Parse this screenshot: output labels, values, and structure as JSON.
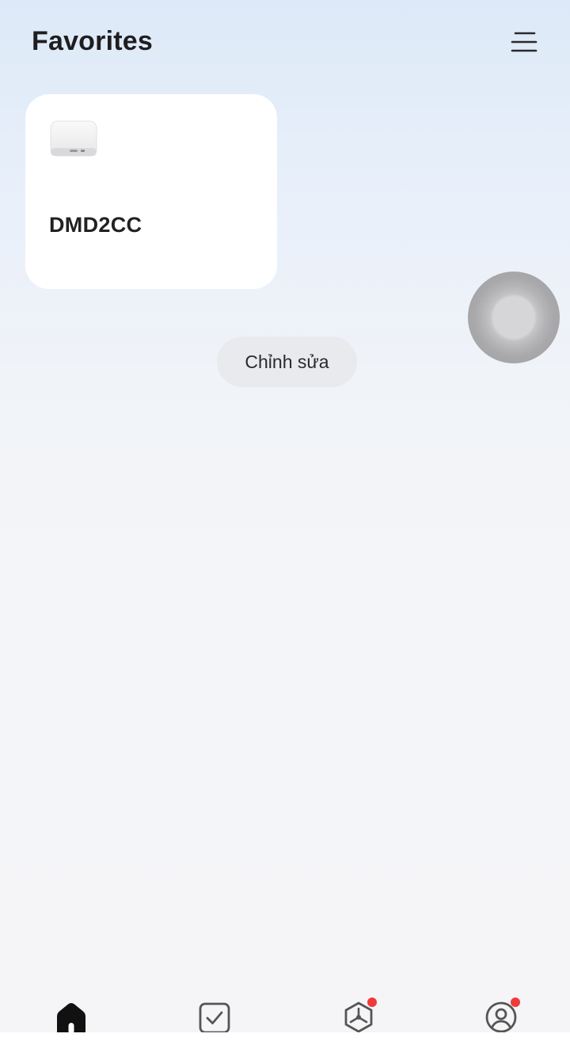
{
  "header": {
    "title": "Favorites",
    "menu_icon": "hamburger-menu-icon"
  },
  "favorites": [
    {
      "name": "DMD2CC",
      "icon": "gateway-device-icon"
    }
  ],
  "edit_button": {
    "label": "Chỉnh sửa"
  },
  "floating_button": {
    "icon": "assistive-touch-icon"
  },
  "bottom_nav": {
    "tabs": [
      {
        "icon": "home-icon",
        "active": true,
        "badge": false
      },
      {
        "icon": "checkbox-icon",
        "active": false,
        "badge": false
      },
      {
        "icon": "smart-icon",
        "active": false,
        "badge": true
      },
      {
        "icon": "profile-icon",
        "active": false,
        "badge": true
      }
    ],
    "badge_color": "#f03a3a",
    "active_color": "#111111",
    "inactive_color": "#555555"
  }
}
